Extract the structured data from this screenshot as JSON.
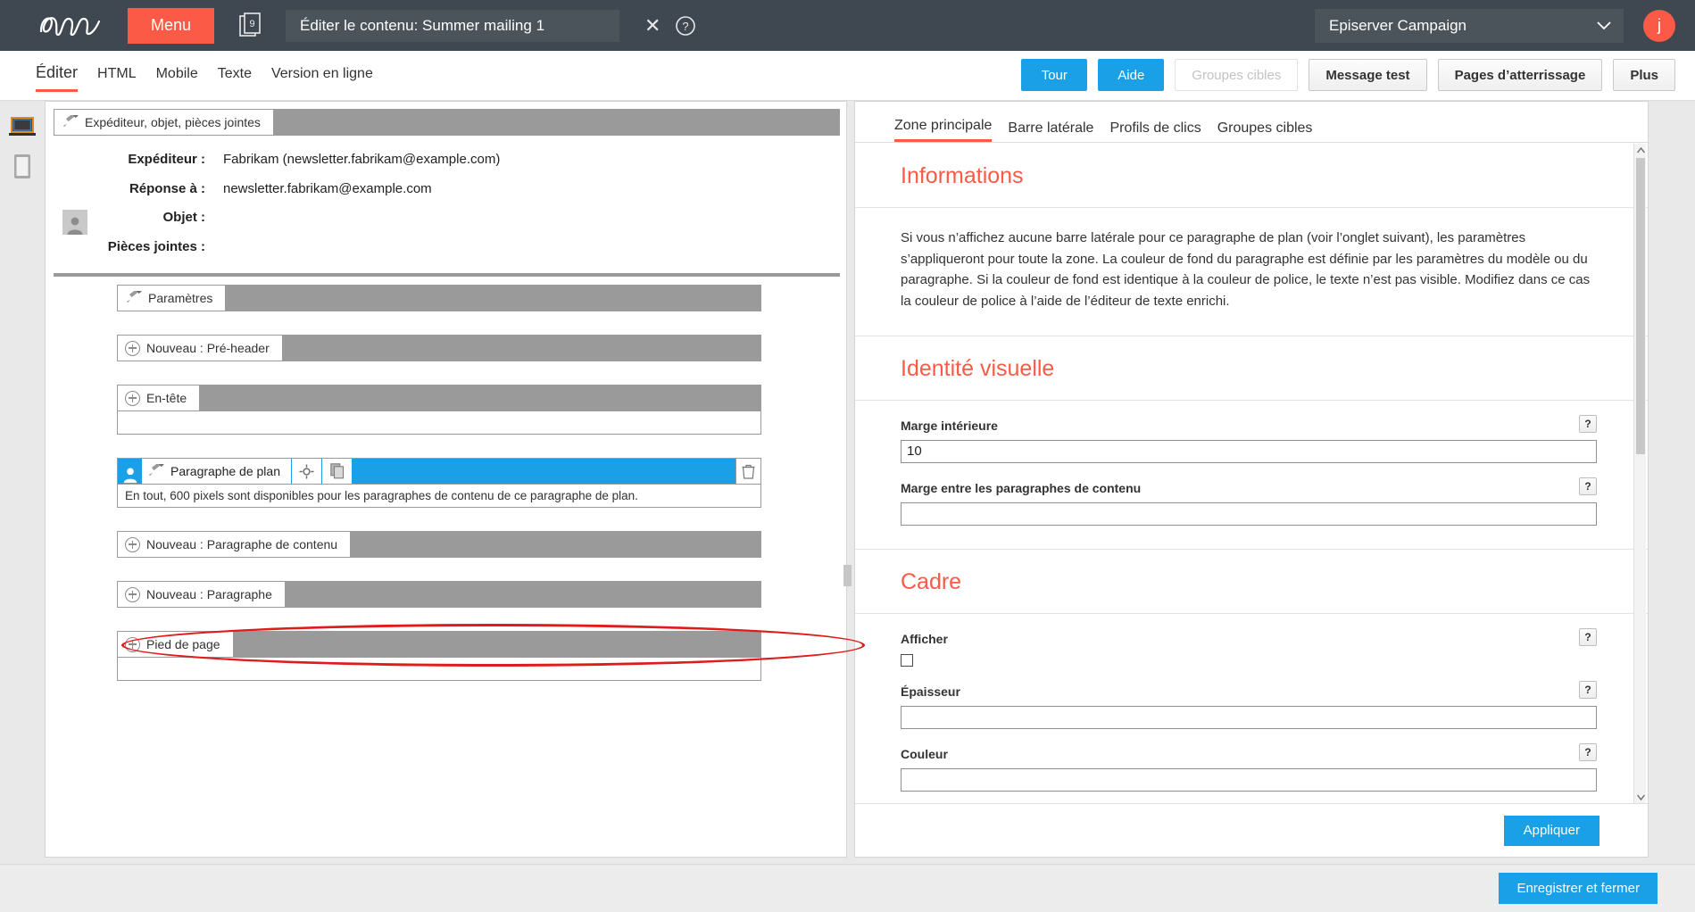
{
  "header": {
    "logo": "epi-logo",
    "menu_label": "Menu",
    "stack_badge": "9",
    "document_title": "Éditer le contenu: Summer mailing 1",
    "close_label": "✕",
    "app_selector": "Episerver Campaign",
    "avatar_initial": "j"
  },
  "toolbar": {
    "tabs": [
      {
        "label": "Éditer",
        "active": true
      },
      {
        "label": "HTML",
        "active": false
      },
      {
        "label": "Mobile",
        "active": false
      },
      {
        "label": "Texte",
        "active": false
      },
      {
        "label": "Version en ligne",
        "active": false
      }
    ],
    "buttons": [
      {
        "label": "Tour",
        "style": "blue"
      },
      {
        "label": "Aide",
        "style": "blue"
      },
      {
        "label": "Groupes cibles",
        "style": "ghost"
      },
      {
        "label": "Message test",
        "style": "grey"
      },
      {
        "label": "Pages d’atterrissage",
        "style": "grey"
      },
      {
        "label": "Plus",
        "style": "grey"
      }
    ]
  },
  "rail": {
    "desktop_icon": "desktop-preview-icon",
    "mobile_icon": "mobile-preview-icon"
  },
  "editor": {
    "sender_bar_label": "Expéditeur, objet, pièces jointes",
    "fields": [
      {
        "label": "Expéditeur :",
        "value": "Fabrikam (newsletter.fabrikam@example.com)"
      },
      {
        "label": "Réponse à :",
        "value": "newsletter.fabrikam@example.com"
      },
      {
        "label": "Objet :",
        "value": ""
      },
      {
        "label": "Pièces jointes :",
        "value": ""
      }
    ],
    "rows": [
      {
        "label": "Paramètres",
        "icon": "brush-icon"
      },
      {
        "label": "Nouveau : Pré-header",
        "icon": "plus-circle-icon"
      },
      {
        "label": "En-tête",
        "icon": "plus-circle-icon"
      }
    ],
    "selected_row": {
      "label": "Paragraphe de plan",
      "person_icon": "person-icon",
      "brush_icon": "brush-icon",
      "target_icon": "target-icon",
      "copy_icon": "copy-icon",
      "trash_icon": "trash-icon",
      "note": "En tout, 600 pixels sont disponibles pour les paragraphes de contenu de ce paragraphe de plan."
    },
    "rows_after": [
      {
        "label": "Nouveau : Paragraphe de contenu",
        "icon": "plus-circle-icon",
        "highlighted": true
      },
      {
        "label": "Nouveau : Paragraphe",
        "icon": "plus-circle-icon",
        "highlighted": false
      },
      {
        "label": "Pied de page",
        "icon": "plus-circle-icon",
        "highlighted": false
      }
    ],
    "annotation": {
      "shape": "ellipse",
      "color": "#e01b1b"
    }
  },
  "right_panel": {
    "tabs": [
      {
        "label": "Zone principale",
        "active": true
      },
      {
        "label": "Barre latérale",
        "active": false
      },
      {
        "label": "Profils de clics",
        "active": false
      },
      {
        "label": "Groupes cibles",
        "active": false
      }
    ],
    "sections": [
      {
        "title": "Informations",
        "text": "Si vous n’affichez aucune barre latérale pour ce paragraphe de plan (voir l’onglet suivant), les paramètres s’appliqueront pour toute la zone. La couleur de fond du paragraphe est définie par les paramètres du modèle ou du paragraphe. Si la couleur de fond est identique à la couleur de police, le texte n’est pas visible. Modifiez dans ce cas la couleur de police à l’aide de l’éditeur de texte enrichi."
      },
      {
        "title": "Identité visuelle",
        "fields": [
          {
            "label": "Marge intérieure",
            "value": "10",
            "type": "text",
            "help": "?"
          },
          {
            "label": "Marge entre les paragraphes de contenu",
            "value": "",
            "type": "text",
            "help": "?"
          }
        ]
      },
      {
        "title": "Cadre",
        "fields": [
          {
            "label": "Afficher",
            "value": "",
            "type": "checkbox",
            "checked": false,
            "help": "?"
          },
          {
            "label": "Épaisseur",
            "value": "",
            "type": "text",
            "help": "?"
          },
          {
            "label": "Couleur",
            "value": "",
            "type": "text",
            "help": "?"
          }
        ]
      }
    ],
    "apply_label": "Appliquer",
    "scrollbar": {
      "up_icon": "chevron-up-icon",
      "down_icon": "chevron-down-icon"
    }
  },
  "footer": {
    "save_label": "Enregistrer et fermer"
  },
  "colors": {
    "brand_orange": "#fa5a46",
    "accent_blue": "#1aa0e6",
    "dark_bar": "#3f4750",
    "annotation_red": "#e01b1b"
  }
}
